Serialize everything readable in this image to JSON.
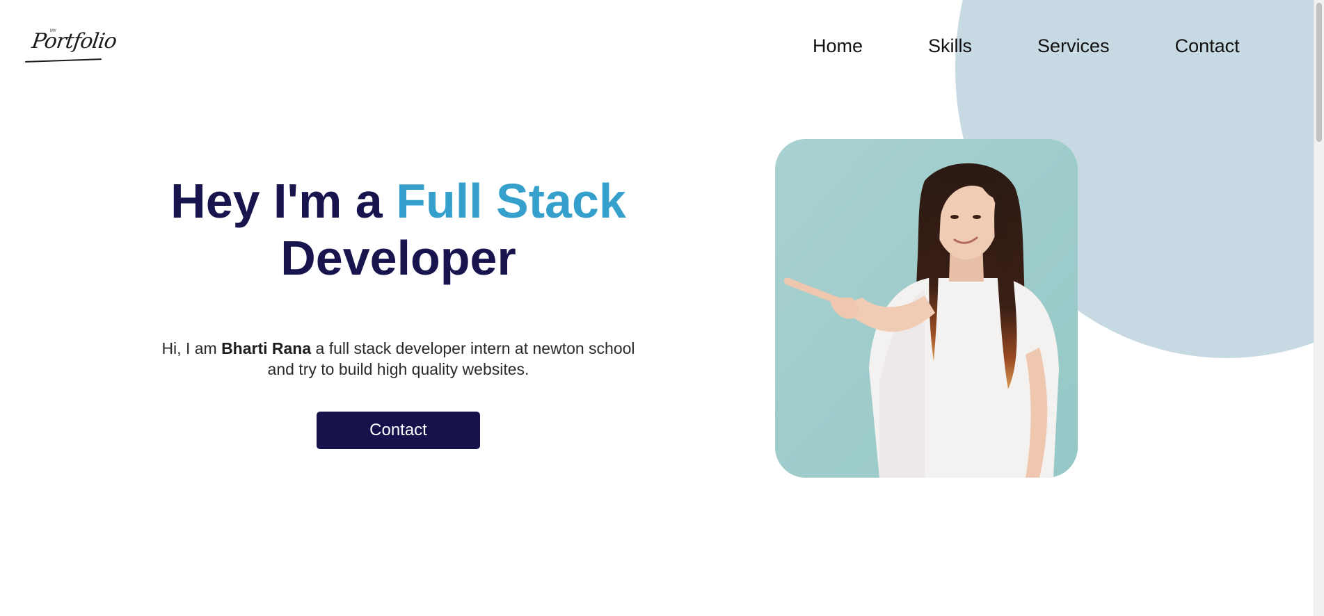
{
  "header": {
    "logo": {
      "text": "Portfolio",
      "small_text": "MY"
    },
    "nav": [
      {
        "label": "Home"
      },
      {
        "label": "Skills"
      },
      {
        "label": "Services"
      },
      {
        "label": "Contact"
      }
    ]
  },
  "hero": {
    "title_prefix": "Hey I'm a ",
    "title_accent": "Full Stack",
    "title_suffix": "Developer",
    "desc_prefix": "Hi, I am ",
    "desc_name": "Bharti Rana",
    "desc_rest": " a full stack developer intern at newton school and try to build high quality websites.",
    "button_label": "Contact",
    "photo_icon": "woman-pointing-photo"
  },
  "colors": {
    "title": "#17144e",
    "accent": "#36a0cc",
    "button_bg": "#16124c",
    "blob": "#c7d9e3",
    "photo_bg": "#a3cfcf"
  }
}
